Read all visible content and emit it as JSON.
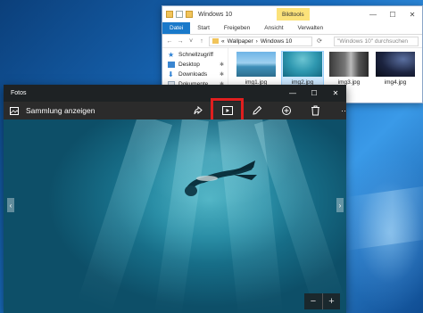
{
  "explorer": {
    "title": "Windows 10",
    "tool_tab": "Bildtools",
    "tabs": [
      "Datei",
      "Start",
      "Freigeben",
      "Ansicht",
      "Verwalten"
    ],
    "address": {
      "prefix": "«",
      "parts": [
        "Wallpaper",
        "Windows 10"
      ]
    },
    "search_placeholder": "\"Windows 10\" durchsuchen",
    "nav": [
      {
        "label": "Schnellzugriff",
        "icon": "star-icon"
      },
      {
        "label": "Desktop",
        "icon": "desktop-icon",
        "pinned": true
      },
      {
        "label": "Downloads",
        "icon": "download-icon",
        "pinned": true
      },
      {
        "label": "Dokumente",
        "icon": "document-icon",
        "pinned": true
      }
    ],
    "files": [
      {
        "name": "img1.jpg",
        "selected": false
      },
      {
        "name": "img2.jpg",
        "selected": true
      },
      {
        "name": "img3.jpg",
        "selected": false
      },
      {
        "name": "img4.jpg",
        "selected": false
      }
    ]
  },
  "photos": {
    "app_title": "Fotos",
    "collection_label": "Sammlung anzeigen",
    "tools": [
      {
        "name": "share-icon"
      },
      {
        "name": "slideshow-icon",
        "highlighted": true
      },
      {
        "name": "edit-pencil-icon"
      },
      {
        "name": "enhance-icon"
      },
      {
        "name": "delete-icon"
      },
      {
        "name": "more-icon",
        "label": "···"
      }
    ],
    "zoom": {
      "minus": "−",
      "plus": "+"
    },
    "highlight_color": "#e01f1f"
  },
  "window_controls": {
    "minimize": "—",
    "maximize": "☐",
    "close": "✕"
  }
}
